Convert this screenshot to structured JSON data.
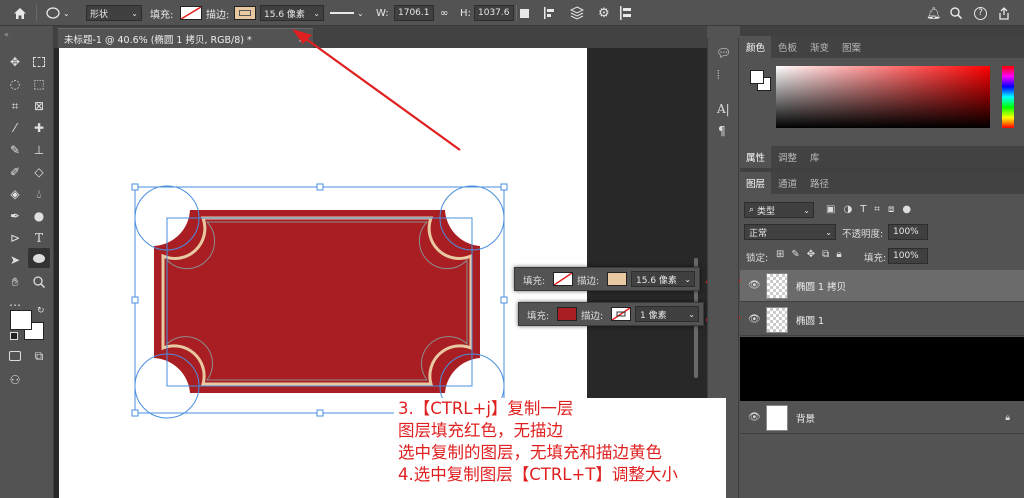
{
  "options_bar": {
    "mode_label": "形状",
    "fill_label": "填充:",
    "stroke_label": "描边:",
    "stroke_width": "15.6 像素",
    "w_label": "W:",
    "w_value": "1706.1",
    "h_label": "H:",
    "h_value": "1037.6",
    "icons": [
      "home-icon",
      "ellipse-tool-icon",
      "align-icon",
      "path-ops-icon",
      "gear-icon",
      "bell-icon",
      "search-icon",
      "help-icon",
      "share-icon"
    ]
  },
  "document_tab": {
    "title": "未标题-1 @ 40.6% (椭圆 1 拷贝, RGB/8) *",
    "close": "×"
  },
  "panels": {
    "color_tabs": [
      "颜色",
      "色板",
      "渐变",
      "图案"
    ],
    "props_tabs": [
      "属性",
      "调整",
      "库"
    ],
    "layer_tabs": [
      "图层",
      "通道",
      "路径"
    ],
    "kind_filter": "类型",
    "blend_mode": "正常",
    "opacity_label": "不透明度:",
    "opacity_value": "100%",
    "lock_label": "锁定:",
    "fill_label": "填充:",
    "fill_value": "100%",
    "layers": [
      {
        "name": "椭圆 1 拷贝"
      },
      {
        "name": "椭圆 1"
      },
      {
        "name": "背景"
      }
    ]
  },
  "float_bar_1": {
    "fill_label": "填充:",
    "stroke_label": "描边:",
    "stroke_width": "15.6 像素"
  },
  "float_bar_2": {
    "fill_label": "填充:",
    "stroke_label": "描边:",
    "stroke_width": "1 像素"
  },
  "annotation": {
    "lines": [
      "3.【CTRL+j】复制一层",
      "图层填充红色，无描边",
      "选中复制的图层，无填充和描边黄色",
      "4.选中复制图层【CTRL+T】调整大小"
    ]
  },
  "colors": {
    "shape_red": "#a81e22",
    "stroke_beige": "#e9c9a2",
    "annotation_red": "#e02020",
    "selection_blue": "#4a8fe0"
  }
}
